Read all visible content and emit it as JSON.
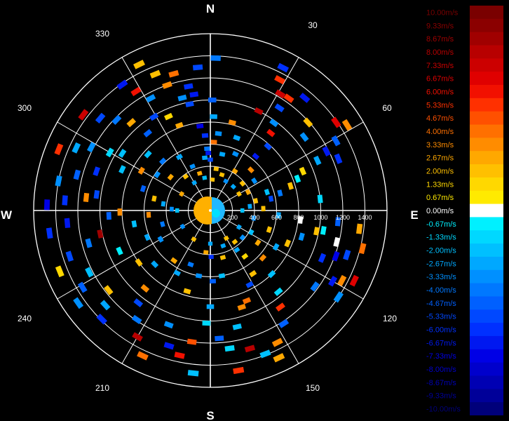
{
  "chart_data": {
    "type": "heatmap",
    "subtype": "polar-radar",
    "compass": {
      "north": "N",
      "east": "E",
      "south": "S",
      "west": "W"
    },
    "angle_labels": [
      "30",
      "60",
      "120",
      "150",
      "210",
      "240",
      "300",
      "330"
    ],
    "range_labels": [
      "200",
      "400",
      "600",
      "800",
      "1000",
      "1200",
      "1400"
    ],
    "range_rings": [
      200,
      400,
      600,
      800,
      1000,
      1200,
      1400,
      1600
    ],
    "range_max": 1600,
    "grid": true,
    "colorbar": {
      "unit": "m/s",
      "labels": [
        "10.00m/s",
        "9.33m/s",
        "8.67m/s",
        "8.00m/s",
        "7.33m/s",
        "6.67m/s",
        "6.00m/s",
        "5.33m/s",
        "4.67m/s",
        "4.00m/s",
        "3.33m/s",
        "2.67m/s",
        "2.00m/s",
        "1.33m/s",
        "0.67m/s",
        "0.00m/s",
        "-0.67m/s",
        "-1.33m/s",
        "-2.00m/s",
        "-2.67m/s",
        "-3.33m/s",
        "-4.00m/s",
        "-4.67m/s",
        "-5.33m/s",
        "-6.00m/s",
        "-6.67m/s",
        "-7.33m/s",
        "-8.00m/s",
        "-8.67m/s",
        "-9.33m/s",
        "-10.00m/s"
      ],
      "colors": [
        "#7a0000",
        "#8b0000",
        "#a00000",
        "#b80000",
        "#cc0000",
        "#e00000",
        "#f21000",
        "#ff3000",
        "#ff5000",
        "#ff7000",
        "#ff8c00",
        "#ffa800",
        "#ffc000",
        "#ffd800",
        "#ffea00",
        "#ffffff",
        "#00f0ff",
        "#00d8ff",
        "#00c0ff",
        "#00a8ff",
        "#0090ff",
        "#0078ff",
        "#0060ff",
        "#0048ff",
        "#0030ff",
        "#0018f0",
        "#0000e6",
        "#0000cc",
        "#0000b3",
        "#000099",
        "#00007a"
      ]
    },
    "points": [
      {
        "az": 2,
        "r": 1380,
        "v": -4.0
      },
      {
        "az": 355,
        "r": 1300,
        "v": -5.3
      },
      {
        "az": 350,
        "r": 1140,
        "v": -6.0
      },
      {
        "az": 352,
        "r": 1060,
        "v": -6.7
      },
      {
        "az": 349,
        "r": 980,
        "v": -5.3
      },
      {
        "az": 345,
        "r": 1280,
        "v": 4.0
      },
      {
        "az": 341,
        "r": 1200,
        "v": 3.3
      },
      {
        "az": 338,
        "r": 1330,
        "v": 2.0
      },
      {
        "az": 346,
        "r": 1050,
        "v": -3.3
      },
      {
        "az": 340,
        "r": 820,
        "v": 2.7
      },
      {
        "az": 336,
        "r": 930,
        "v": 1.3
      },
      {
        "az": 353,
        "r": 770,
        "v": -7.3
      },
      {
        "az": 356,
        "r": 680,
        "v": -6.0
      },
      {
        "az": 357,
        "r": 560,
        "v": -4.0
      },
      {
        "az": 354,
        "r": 480,
        "v": -2.7
      },
      {
        "az": 0,
        "r": 460,
        "v": -5.3
      },
      {
        "az": 3,
        "r": 620,
        "v": 4.0
      },
      {
        "az": 2,
        "r": 850,
        "v": -2.7
      },
      {
        "az": 1,
        "r": 1000,
        "v": -4.7
      },
      {
        "az": 358,
        "r": 520,
        "v": -6.7
      },
      {
        "az": 27,
        "r": 1450,
        "v": -6.0
      },
      {
        "az": 28,
        "r": 1340,
        "v": 5.3
      },
      {
        "az": 31,
        "r": 1230,
        "v": 7.3
      },
      {
        "az": 34,
        "r": 1120,
        "v": -5.3
      },
      {
        "az": 26,
        "r": 1000,
        "v": 8.0
      },
      {
        "az": 36,
        "r": 980,
        "v": -3.3
      },
      {
        "az": 38,
        "r": 890,
        "v": 6.0
      },
      {
        "az": 42,
        "r": 780,
        "v": -5.3
      },
      {
        "az": 40,
        "r": 640,
        "v": -6.7
      },
      {
        "az": 45,
        "r": 520,
        "v": 3.3
      },
      {
        "az": 35,
        "r": 1240,
        "v": 5.3
      },
      {
        "az": 40,
        "r": 1330,
        "v": -6.7
      },
      {
        "az": 48,
        "r": 1190,
        "v": 2.0
      },
      {
        "az": 52,
        "r": 1080,
        "v": -3.3
      },
      {
        "az": 55,
        "r": 1390,
        "v": 6.7
      },
      {
        "az": 58,
        "r": 1460,
        "v": 3.3
      },
      {
        "az": 61,
        "r": 1300,
        "v": -4.7
      },
      {
        "az": 63,
        "r": 1180,
        "v": -6.7
      },
      {
        "az": 65,
        "r": 1070,
        "v": -2.7
      },
      {
        "az": 67,
        "r": 910,
        "v": 1.3
      },
      {
        "az": 70,
        "r": 840,
        "v": -0.5
      },
      {
        "az": 73,
        "r": 760,
        "v": 2.0
      },
      {
        "az": 76,
        "r": 650,
        "v": -4.0
      },
      {
        "az": 79,
        "r": 560,
        "v": -5.3
      },
      {
        "az": 68,
        "r": 1250,
        "v": -6.0
      },
      {
        "az": 95,
        "r": 1160,
        "v": -4.7
      },
      {
        "az": 97,
        "r": 1360,
        "v": 2.7
      },
      {
        "az": 101,
        "r": 980,
        "v": 2.0
      },
      {
        "az": 104,
        "r": 1420,
        "v": 4.0
      },
      {
        "az": 108,
        "r": 1300,
        "v": -5.3
      },
      {
        "az": 110,
        "r": 1210,
        "v": -7.3
      },
      {
        "az": 113,
        "r": 1100,
        "v": -6.0
      },
      {
        "az": 116,
        "r": 1450,
        "v": 6.7
      },
      {
        "az": 118,
        "r": 1350,
        "v": 3.3
      },
      {
        "az": 120,
        "r": 1280,
        "v": -6.7
      },
      {
        "az": 124,
        "r": 1400,
        "v": -3.3
      },
      {
        "az": 126,
        "r": 1170,
        "v": -4.0
      },
      {
        "az": 106,
        "r": 860,
        "v": -3.3
      },
      {
        "az": 113,
        "r": 760,
        "v": 2.0
      },
      {
        "az": 119,
        "r": 680,
        "v": -2.7
      },
      {
        "az": 132,
        "r": 640,
        "v": 3.3
      },
      {
        "az": 136,
        "r": 800,
        "v": -2.0
      },
      {
        "az": 140,
        "r": 960,
        "v": -1.3
      },
      {
        "az": 144,
        "r": 1080,
        "v": 5.3
      },
      {
        "az": 147,
        "r": 1220,
        "v": -4.7
      },
      {
        "az": 153,
        "r": 1340,
        "v": 3.3
      },
      {
        "az": 155,
        "r": 1470,
        "v": 2.7
      },
      {
        "az": 159,
        "r": 1390,
        "v": -2.0
      },
      {
        "az": 164,
        "r": 1300,
        "v": 8.0
      },
      {
        "az": 170,
        "r": 1470,
        "v": 5.3
      },
      {
        "az": 172,
        "r": 1260,
        "v": -1.3
      },
      {
        "az": 176,
        "r": 1160,
        "v": -4.7
      },
      {
        "az": 167,
        "r": 1080,
        "v": -2.0
      },
      {
        "az": 162,
        "r": 920,
        "v": 3.3
      },
      {
        "az": 152,
        "r": 760,
        "v": -5.3
      },
      {
        "az": 158,
        "r": 880,
        "v": 4.0
      },
      {
        "az": 146,
        "r": 690,
        "v": 2.0
      },
      {
        "az": 143,
        "r": 520,
        "v": 1.3
      },
      {
        "az": 146,
        "r": 430,
        "v": -2.7
      },
      {
        "az": 142,
        "r": 360,
        "v": 2.0
      },
      {
        "az": 178,
        "r": 640,
        "v": -4.7
      },
      {
        "az": 179,
        "r": 420,
        "v": -6.0
      },
      {
        "az": 180,
        "r": 870,
        "v": -2.7
      },
      {
        "az": 182,
        "r": 1020,
        "v": -1.3
      },
      {
        "az": 186,
        "r": 1480,
        "v": -2.0
      },
      {
        "az": 188,
        "r": 1200,
        "v": 4.7
      },
      {
        "az": 192,
        "r": 1340,
        "v": 6.0
      },
      {
        "az": 197,
        "r": 1280,
        "v": -6.7
      },
      {
        "az": 200,
        "r": 1100,
        "v": -3.3
      },
      {
        "az": 205,
        "r": 1450,
        "v": 4.0
      },
      {
        "az": 210,
        "r": 1320,
        "v": 8.0
      },
      {
        "az": 214,
        "r": 1190,
        "v": -4.0
      },
      {
        "az": 218,
        "r": 1060,
        "v": -5.3
      },
      {
        "az": 220,
        "r": 920,
        "v": 3.3
      },
      {
        "az": 225,
        "r": 1390,
        "v": -6.0
      },
      {
        "az": 228,
        "r": 1280,
        "v": -2.7
      },
      {
        "az": 232,
        "r": 1170,
        "v": 2.0
      },
      {
        "az": 235,
        "r": 1460,
        "v": -3.3
      },
      {
        "az": 239,
        "r": 1350,
        "v": -4.7
      },
      {
        "az": 243,
        "r": 1230,
        "v": -2.0
      },
      {
        "az": 248,
        "r": 1470,
        "v": 1.3
      },
      {
        "az": 252,
        "r": 1340,
        "v": -5.3
      },
      {
        "az": 255,
        "r": 1140,
        "v": -4.0
      },
      {
        "az": 258,
        "r": 1020,
        "v": 8.7
      },
      {
        "az": 262,
        "r": 1470,
        "v": -6.0
      },
      {
        "az": 265,
        "r": 1300,
        "v": -6.7
      },
      {
        "az": 267,
        "r": 920,
        "v": -4.7
      },
      {
        "az": 269,
        "r": 820,
        "v": 3.3
      },
      {
        "az": 272,
        "r": 1480,
        "v": -7.3
      },
      {
        "az": 274,
        "r": 1320,
        "v": -6.0
      },
      {
        "az": 276,
        "r": 1130,
        "v": 3.3
      },
      {
        "az": 278,
        "r": 1040,
        "v": -5.3
      },
      {
        "az": 281,
        "r": 1400,
        "v": -3.3
      },
      {
        "az": 285,
        "r": 1250,
        "v": -4.7
      },
      {
        "az": 289,
        "r": 1090,
        "v": -6.0
      },
      {
        "az": 292,
        "r": 1480,
        "v": 5.3
      },
      {
        "az": 295,
        "r": 1340,
        "v": -2.7
      },
      {
        "az": 298,
        "r": 1220,
        "v": -3.3
      },
      {
        "az": 300,
        "r": 1050,
        "v": -1.3
      },
      {
        "az": 303,
        "r": 950,
        "v": -2.0
      },
      {
        "az": 307,
        "r": 1440,
        "v": 7.3
      },
      {
        "az": 310,
        "r": 1300,
        "v": -5.3
      },
      {
        "az": 314,
        "r": 1180,
        "v": -4.0
      },
      {
        "az": 318,
        "r": 1070,
        "v": 2.7
      },
      {
        "az": 321,
        "r": 900,
        "v": -4.7
      },
      {
        "az": 325,
        "r": 1390,
        "v": -6.7
      },
      {
        "az": 328,
        "r": 1270,
        "v": 6.0
      },
      {
        "az": 332,
        "r": 1150,
        "v": -3.3
      },
      {
        "az": 334,
        "r": 1470,
        "v": 2.0
      },
      {
        "az": 329,
        "r": 990,
        "v": -5.3
      },
      {
        "az": 295,
        "r": 880,
        "v": -2.0
      },
      {
        "az": 300,
        "r": 720,
        "v": 3.3
      },
      {
        "az": 304,
        "r": 580,
        "v": -3.3
      },
      {
        "az": 310,
        "r": 470,
        "v": 2.7
      },
      {
        "az": 316,
        "r": 620,
        "v": -4.0
      },
      {
        "az": 288,
        "r": 640,
        "v": -4.7
      },
      {
        "az": 282,
        "r": 520,
        "v": 2.0
      },
      {
        "az": 278,
        "r": 430,
        "v": -2.7
      },
      {
        "az": 272,
        "r": 350,
        "v": -3.3
      },
      {
        "az": 266,
        "r": 560,
        "v": 3.3
      },
      {
        "az": 260,
        "r": 700,
        "v": -2.0
      },
      {
        "az": 254,
        "r": 450,
        "v": -4.0
      },
      {
        "az": 247,
        "r": 620,
        "v": -2.7
      },
      {
        "az": 240,
        "r": 520,
        "v": -3.3
      },
      {
        "az": 234,
        "r": 800,
        "v": 2.0
      },
      {
        "az": 226,
        "r": 700,
        "v": -2.7
      },
      {
        "az": 216,
        "r": 560,
        "v": 2.7
      },
      {
        "az": 208,
        "r": 640,
        "v": -2.7
      },
      {
        "az": 200,
        "r": 520,
        "v": -4.0
      },
      {
        "az": 196,
        "r": 760,
        "v": 2.0
      },
      {
        "az": 190,
        "r": 600,
        "v": -3.3
      },
      {
        "az": 186,
        "r": 380,
        "v": 2.7
      },
      {
        "az": 170,
        "r": 600,
        "v": -2.0
      },
      {
        "az": 165,
        "r": 440,
        "v": 2.0
      },
      {
        "az": 160,
        "r": 340,
        "v": -2.7
      },
      {
        "az": 130,
        "r": 380,
        "v": -3.3
      },
      {
        "az": 124,
        "r": 520,
        "v": 2.7
      },
      {
        "az": 118,
        "r": 420,
        "v": -2.0
      },
      {
        "az": 108,
        "r": 560,
        "v": 2.0
      },
      {
        "az": 100,
        "r": 400,
        "v": -3.3
      },
      {
        "az": 94,
        "r": 620,
        "v": -2.7
      },
      {
        "az": 88,
        "r": 480,
        "v": 2.0
      },
      {
        "az": 84,
        "r": 360,
        "v": -2.7
      },
      {
        "az": 78,
        "r": 420,
        "v": 2.0
      },
      {
        "az": 72,
        "r": 540,
        "v": -2.0
      },
      {
        "az": 64,
        "r": 380,
        "v": 2.7
      },
      {
        "az": 56,
        "r": 480,
        "v": -3.3
      },
      {
        "az": 50,
        "r": 380,
        "v": 2.0
      },
      {
        "az": 44,
        "r": 300,
        "v": -2.7
      },
      {
        "az": 32,
        "r": 420,
        "v": 2.7
      },
      {
        "az": 24,
        "r": 560,
        "v": -3.3
      },
      {
        "az": 18,
        "r": 340,
        "v": 2.0
      },
      {
        "az": 12,
        "r": 520,
        "v": -2.7
      },
      {
        "az": 8,
        "r": 380,
        "v": 2.0
      },
      {
        "az": 6,
        "r": 700,
        "v": -3.3
      },
      {
        "az": 14,
        "r": 820,
        "v": 3.3
      },
      {
        "az": 20,
        "r": 700,
        "v": -2.7
      },
      {
        "az": 330,
        "r": 560,
        "v": -2.7
      },
      {
        "az": 324,
        "r": 380,
        "v": 2.0
      },
      {
        "az": 338,
        "r": 430,
        "v": -3.3
      },
      {
        "az": 344,
        "r": 350,
        "v": 2.7
      },
      {
        "az": 350,
        "r": 300,
        "v": -2.0
      },
      {
        "az": 4,
        "r": 280,
        "v": 2.0
      },
      {
        "az": 28,
        "r": 300,
        "v": -3.3
      },
      {
        "az": 60,
        "r": 300,
        "v": 2.0
      },
      {
        "az": 90,
        "r": 290,
        "v": -2.0
      },
      {
        "az": 120,
        "r": 300,
        "v": -2.7
      },
      {
        "az": 150,
        "r": 290,
        "v": 2.0
      },
      {
        "az": 180,
        "r": 300,
        "v": -2.7
      },
      {
        "az": 210,
        "r": 300,
        "v": 2.0
      },
      {
        "az": 240,
        "r": 290,
        "v": -3.3
      },
      {
        "az": 270,
        "r": 300,
        "v": -2.0
      },
      {
        "az": 300,
        "r": 300,
        "v": 2.7
      },
      {
        "az": 330,
        "r": 290,
        "v": -2.7
      },
      {
        "az": 96,
        "r": 820,
        "v": -0.3
      },
      {
        "az": 100,
        "r": 1040,
        "v": -0.5
      },
      {
        "az": 104,
        "r": 1180,
        "v": -0.3
      },
      {
        "az": 246,
        "r": 900,
        "v": -0.4
      },
      {
        "az": 312,
        "r": 760,
        "v": -2.0
      },
      {
        "az": 84,
        "r": 1000,
        "v": -1.3
      }
    ]
  }
}
